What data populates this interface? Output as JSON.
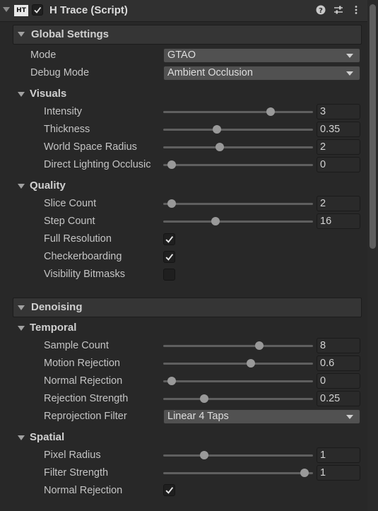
{
  "header": {
    "badge": "HT",
    "title": "H Trace (Script)",
    "enabled": true,
    "icons": [
      "help-icon",
      "preset-sliders-icon",
      "kebab-menu-icon"
    ]
  },
  "global_settings": {
    "title": "Global Settings",
    "mode_label": "Mode",
    "mode_value": "GTAO",
    "debug_label": "Debug Mode",
    "debug_value": "Ambient Occlusion"
  },
  "visuals": {
    "title": "Visuals",
    "intensity": {
      "label": "Intensity",
      "value": "3",
      "slider_fraction": 0.73
    },
    "thickness": {
      "label": "Thickness",
      "value": "0.35",
      "slider_fraction": 0.35
    },
    "world_radius": {
      "label": "World Space Radius",
      "value": "2",
      "slider_fraction": 0.37
    },
    "direct_lighting": {
      "label": "Direct Lighting Occlusic",
      "value": "0",
      "slider_fraction": 0.03
    }
  },
  "quality": {
    "title": "Quality",
    "slice_count": {
      "label": "Slice Count",
      "value": "2",
      "slider_fraction": 0.03
    },
    "step_count": {
      "label": "Step Count",
      "value": "16",
      "slider_fraction": 0.34
    },
    "full_resolution": {
      "label": "Full Resolution",
      "checked": true
    },
    "checkerboarding": {
      "label": "Checkerboarding",
      "checked": true
    },
    "visibility_bitmasks": {
      "label": "Visibility Bitmasks",
      "checked": false
    }
  },
  "denoising": {
    "title": "Denoising",
    "temporal": {
      "title": "Temporal",
      "sample_count": {
        "label": "Sample Count",
        "value": "8",
        "slider_fraction": 0.65
      },
      "motion_rejection": {
        "label": "Motion Rejection",
        "value": "0.6",
        "slider_fraction": 0.59
      },
      "normal_rejection": {
        "label": "Normal Rejection",
        "value": "0",
        "slider_fraction": 0.03
      },
      "rejection_strength": {
        "label": "Rejection Strength",
        "value": "0.25",
        "slider_fraction": 0.26
      },
      "reprojection_filter": {
        "label": "Reprojection Filter",
        "value": "Linear 4 Taps"
      }
    },
    "spatial": {
      "title": "Spatial",
      "pixel_radius": {
        "label": "Pixel Radius",
        "value": "1",
        "slider_fraction": 0.26
      },
      "filter_strength": {
        "label": "Filter Strength",
        "value": "1",
        "slider_fraction": 0.97
      },
      "normal_rejection": {
        "label": "Normal Rejection",
        "checked": true
      }
    }
  },
  "colors": {
    "background": "#282828",
    "section_header": "#353535",
    "text": "#c4c4c4",
    "slider_knob": "#999999"
  }
}
